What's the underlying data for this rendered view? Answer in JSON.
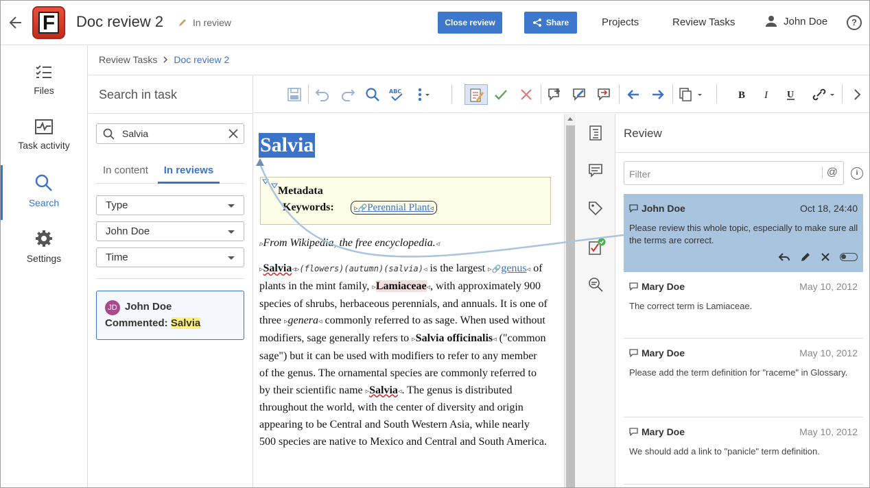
{
  "header": {
    "title": "Doc review 2",
    "status": "In review",
    "close_review": "Close review",
    "share": "Share",
    "projects": "Projects",
    "review_tasks": "Review Tasks",
    "user": "John Doe",
    "help": "?",
    "logo_letter": "F"
  },
  "nav": {
    "files": "Files",
    "task_activity": "Task activity",
    "search": "Search",
    "settings": "Settings"
  },
  "breadcrumb": {
    "parent": "Review Tasks",
    "current": "Doc review 2"
  },
  "search_panel": {
    "title": "Search in task",
    "query": "Salvia",
    "tab_content": "In content",
    "tab_reviews": "In reviews",
    "filter_type": "Type",
    "filter_user": "John Doe",
    "filter_time": "Time",
    "result": {
      "initials": "JD",
      "name": "John Doe",
      "action": "Commented:",
      "match": "Salvia"
    }
  },
  "editor": {
    "heading": "Salvia",
    "metadata_label": "Metadata",
    "keywords_label": "Keywords:",
    "keyword": "Perennial Plant",
    "source": "From Wikipedia, the free encyclopedia.",
    "term": "Salvia",
    "index_terms": "(flowers)(autumn)(salvia)",
    "p1": " is the largest ",
    "genus": "genus",
    "p2": " of plants in the mint family, ",
    "lamiaceae": "Lamiaceae",
    "p3": ", with approximately 900 species of shrubs, herbaceous perennials, and annuals. It is one of three ",
    "genera": "genera",
    "p4": " commonly referred to as sage. When used without modifiers, sage generally refers to ",
    "officinalis": "Salvia officinalis",
    "p5": " (\"common sage\") but it can be used with modifiers to refer to any member of the genus. The ornamental species are commonly referred to by their scientific name ",
    "salvia2": "Salvia",
    "p6": ". The genus is distributed throughout the world, with the center of diversity and origin appearing to be Central and South Western Asia, while nearly 500 species are native to Mexico and Central and South America."
  },
  "review": {
    "title": "Review",
    "filter_placeholder": "Filter",
    "at": "@",
    "info": "i",
    "comments": [
      {
        "author": "John Doe",
        "date": "Oct 18, 24:40",
        "text": "Please review this whole topic, especially to make sure all the terms are correct."
      },
      {
        "author": "Mary Doe",
        "date": "May 10, 2012",
        "text": "The correct term is Lamiaceae."
      },
      {
        "author": "Mary Doe",
        "date": "May 10, 2012",
        "text": "Please add the term definition for \"raceme\" in Glossary."
      },
      {
        "author": "Mary Doe",
        "date": "May 10, 2012",
        "text": "We should add a link to \"panicle\" term definition."
      }
    ]
  },
  "colors": {
    "accent": "#3b73c8",
    "selected_comment": "#a8c4df",
    "highlight": "#fff17a"
  }
}
